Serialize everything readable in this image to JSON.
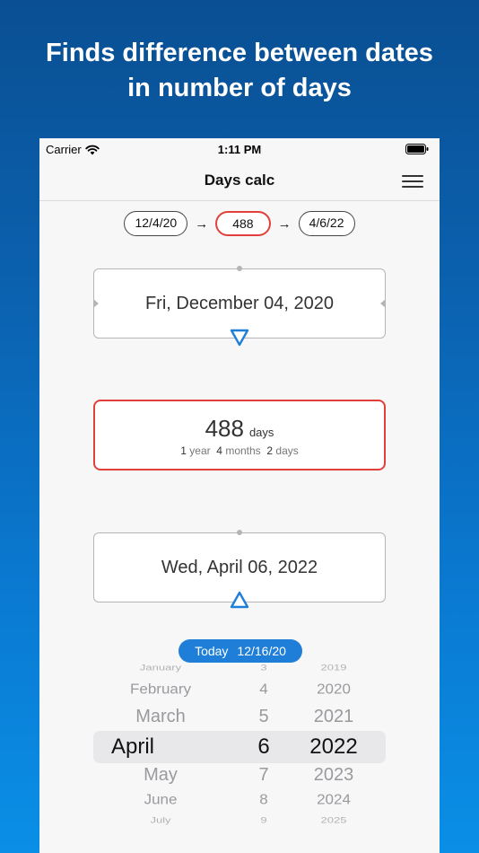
{
  "headline": {
    "line1": "Finds difference between dates",
    "line2": "in number of days"
  },
  "status": {
    "carrier": "Carrier",
    "time": "1:11 PM"
  },
  "navbar": {
    "title": "Days calc"
  },
  "summary": {
    "start": "12/4/20",
    "days": "488",
    "end": "4/6/22",
    "arrow": "→"
  },
  "start_date": {
    "label": "Fri, December 04, 2020"
  },
  "result": {
    "days": "488",
    "unit": "days",
    "years": "1",
    "years_label": "year",
    "months": "4",
    "months_label": "months",
    "days_part": "2",
    "days_part_label": "days"
  },
  "end_date": {
    "label": "Wed, April 06, 2022"
  },
  "today": {
    "label": "Today",
    "date": "12/16/20"
  },
  "picker": {
    "months": [
      "January",
      "February",
      "March",
      "April",
      "May",
      "June",
      "July"
    ],
    "days": [
      "3",
      "4",
      "5",
      "6",
      "7",
      "8",
      "9"
    ],
    "years": [
      "2019",
      "2020",
      "2021",
      "2022",
      "2023",
      "2024",
      "2025"
    ],
    "selected_index": 3
  },
  "colors": {
    "accent_blue": "#1f7fd8",
    "highlight_red": "#e0403a"
  }
}
